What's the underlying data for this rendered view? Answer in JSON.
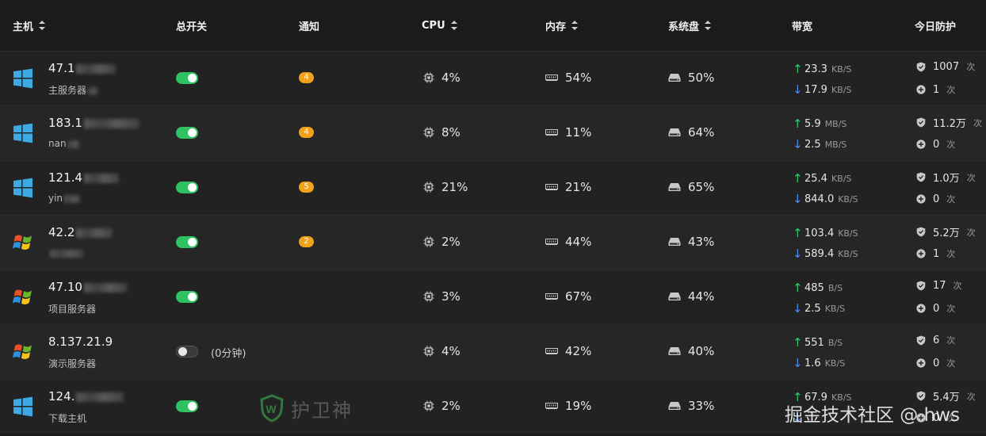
{
  "header": {
    "host": "主机",
    "switch": "总开关",
    "notify": "通知",
    "cpu": "CPU",
    "memory": "内存",
    "disk": "系统盘",
    "bandwidth": "带宽",
    "protect": "今日防护"
  },
  "rows": [
    {
      "os": "windows-10",
      "ip": "47.1",
      "name": "主服务器",
      "switch_on": true,
      "switch_note": "",
      "notify": "4",
      "cpu": "4%",
      "mem": "54%",
      "disk": "50%",
      "up": "23.3",
      "up_unit": "KB/S",
      "down": "17.9",
      "down_unit": "KB/S",
      "prot1": "1007",
      "prot1_unit": "次",
      "prot2": "1",
      "prot2_unit": "次"
    },
    {
      "os": "windows-10",
      "ip": "183.1",
      "name": "nan",
      "switch_on": true,
      "switch_note": "",
      "notify": "4",
      "cpu": "8%",
      "mem": "11%",
      "disk": "64%",
      "up": "5.9",
      "up_unit": "MB/S",
      "down": "2.5",
      "down_unit": "MB/S",
      "prot1": "11.2万",
      "prot1_unit": "次",
      "prot2": "0",
      "prot2_unit": "次"
    },
    {
      "os": "windows-10",
      "ip": "121.4",
      "name": "yin",
      "switch_on": true,
      "switch_note": "",
      "notify": "5",
      "cpu": "21%",
      "mem": "21%",
      "disk": "65%",
      "up": "25.4",
      "up_unit": "KB/S",
      "down": "844.0",
      "down_unit": "KB/S",
      "prot1": "1.0万",
      "prot1_unit": "次",
      "prot2": "0",
      "prot2_unit": "次"
    },
    {
      "os": "windows-xp",
      "ip": "42.2",
      "name": "",
      "switch_on": true,
      "switch_note": "",
      "notify": "2",
      "cpu": "2%",
      "mem": "44%",
      "disk": "43%",
      "up": "103.4",
      "up_unit": "KB/S",
      "down": "589.4",
      "down_unit": "KB/S",
      "prot1": "5.2万",
      "prot1_unit": "次",
      "prot2": "1",
      "prot2_unit": "次"
    },
    {
      "os": "windows-xp",
      "ip": "47.10",
      "name": "项目服务器",
      "switch_on": true,
      "switch_note": "",
      "notify": "",
      "cpu": "3%",
      "mem": "67%",
      "disk": "44%",
      "up": "485",
      "up_unit": "B/S",
      "down": "2.5",
      "down_unit": "KB/S",
      "prot1": "17",
      "prot1_unit": "次",
      "prot2": "0",
      "prot2_unit": "次"
    },
    {
      "os": "windows-xp",
      "ip": "8.137.21.9",
      "name": "演示服务器",
      "switch_on": false,
      "switch_note": "(0分钟)",
      "notify": "",
      "cpu": "4%",
      "mem": "42%",
      "disk": "40%",
      "up": "551",
      "up_unit": "B/S",
      "down": "1.6",
      "down_unit": "KB/S",
      "prot1": "6",
      "prot1_unit": "次",
      "prot2": "0",
      "prot2_unit": "次"
    },
    {
      "os": "windows-10",
      "ip": "124.",
      "name": "下载主机",
      "switch_on": true,
      "switch_note": "",
      "notify": "",
      "cpu": "2%",
      "mem": "19%",
      "disk": "33%",
      "up": "67.9",
      "up_unit": "KB/S",
      "down": "",
      "down_unit": "",
      "prot1": "5.4万",
      "prot1_unit": "次",
      "prot2": "0",
      "prot2_unit": "次"
    }
  ],
  "watermark": "护卫神",
  "site_watermark": "掘金技术社区 @ hws",
  "colors": {
    "toggle_on": "#2ec263",
    "badge": "#f0a21a",
    "arrow_up": "#36c66b",
    "arrow_down": "#4e8fe8"
  }
}
